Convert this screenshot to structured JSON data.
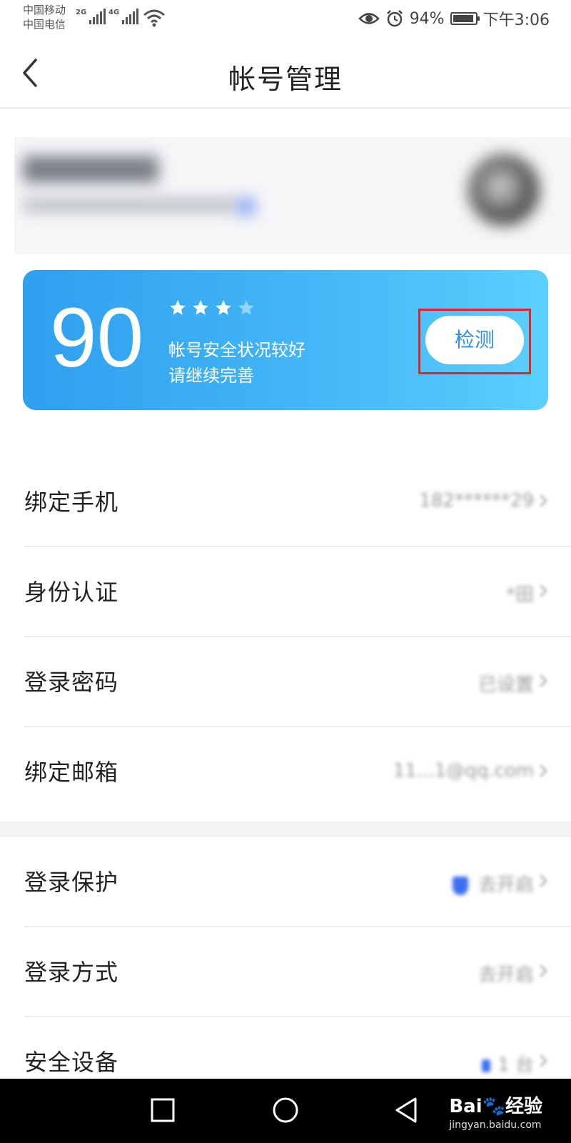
{
  "status_bar": {
    "carrier_1": "中国移动",
    "carrier_2": "中国电信",
    "net_1": "2G",
    "net_2": "4G",
    "battery_percent": "94%",
    "battery_level": 0.94,
    "time": "下午3:06"
  },
  "header": {
    "title": "帐号管理"
  },
  "security_card": {
    "score": "90",
    "rating_filled": 3,
    "rating_total": 4,
    "status_line1": "帐号安全状况较好",
    "status_line2": "请继续完善",
    "check_button": "检测"
  },
  "settings": {
    "section1": [
      {
        "label": "绑定手机",
        "value": "182******29"
      },
      {
        "label": "身份认证",
        "value": "*田"
      },
      {
        "label": "登录密码",
        "value": "已设置"
      },
      {
        "label": "绑定邮箱",
        "value": "11...1@qq.com"
      }
    ],
    "section2": [
      {
        "label": "登录保护",
        "value": "去开启"
      },
      {
        "label": "登录方式",
        "value": "去开启"
      },
      {
        "label": "安全设备",
        "value": "1 台"
      }
    ]
  },
  "watermark": {
    "brand": "Bai",
    "brand_cn": "经验",
    "url": "jingyan.baidu.com"
  },
  "colors": {
    "card_gradient_start": "#2f9fef",
    "card_gradient_end": "#5bcffd",
    "button_text": "#2f8fe0",
    "highlight_border": "#e0261e",
    "accent_blue": "#3b6ef0"
  }
}
